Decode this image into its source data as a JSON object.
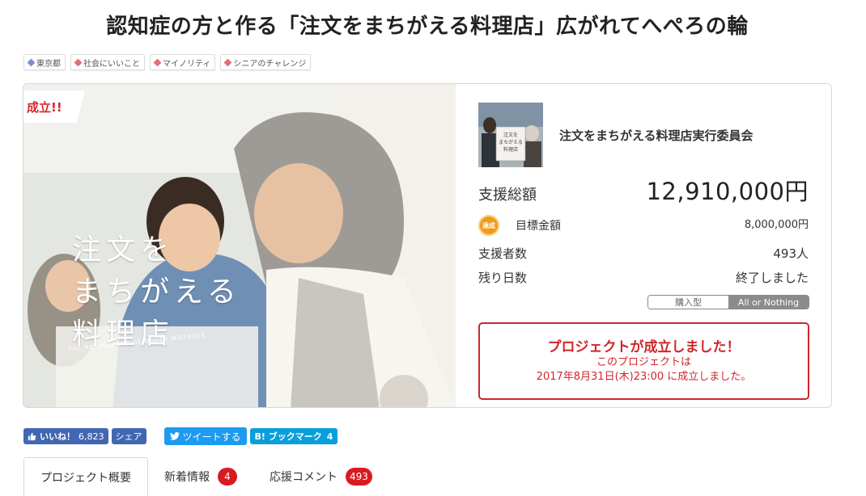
{
  "page": {
    "title": "認知症の方と作る「注文をまちがえる料理店」広がれてへぺろの輪"
  },
  "tags": [
    {
      "label": "東京都",
      "color": "#7a8ed6"
    },
    {
      "label": "社会にいいこと",
      "color": "#e66d7a"
    },
    {
      "label": "マイノリティ",
      "color": "#e66d7a"
    },
    {
      "label": "シニアのチャレンジ",
      "color": "#e66d7a"
    }
  ],
  "hero": {
    "ribbon": "成立!!",
    "logo_line1": "注文を",
    "logo_line2": "まちがえる",
    "logo_line3": "料理店",
    "logo_sub": "THE RESTAURANT OF ORDER MISTAKES"
  },
  "owner": {
    "name": "注文をまちがえる料理店実行委員会"
  },
  "stats": {
    "total_label": "支援総額",
    "total_value": "12,910,000円",
    "goal_badge": "達成",
    "goal_label": "目標金額",
    "goal_value": "8,000,000円",
    "backers_label": "支援者数",
    "backers_value": "493人",
    "remaining_label": "残り日数",
    "remaining_value": "終了しました"
  },
  "type_switch": {
    "purchase": "購入型",
    "all_or_nothing": "All or Nothing"
  },
  "success_box": {
    "headline": "プロジェクトが成立しました！",
    "line1": "このプロジェクトは",
    "line2": "2017年8月31日(木)23:00 に成立しました。"
  },
  "share": {
    "like_label": "いいね！",
    "like_count": "6,823",
    "share_label": "シェア",
    "tweet_label": "ツイートする",
    "hatena_label": "B! ブックマーク",
    "hatena_count": "4"
  },
  "tabs": [
    {
      "label": "プロジェクト概要",
      "badge": ""
    },
    {
      "label": "新着情報",
      "badge": "4"
    },
    {
      "label": "応援コメント",
      "badge": "493"
    }
  ],
  "colors": {
    "accent_red": "#d0252b",
    "facebook": "#4267b2",
    "twitter": "#1d9bf0",
    "hatena": "#0a9fdb",
    "achieved_orange": "#f19a1b"
  }
}
